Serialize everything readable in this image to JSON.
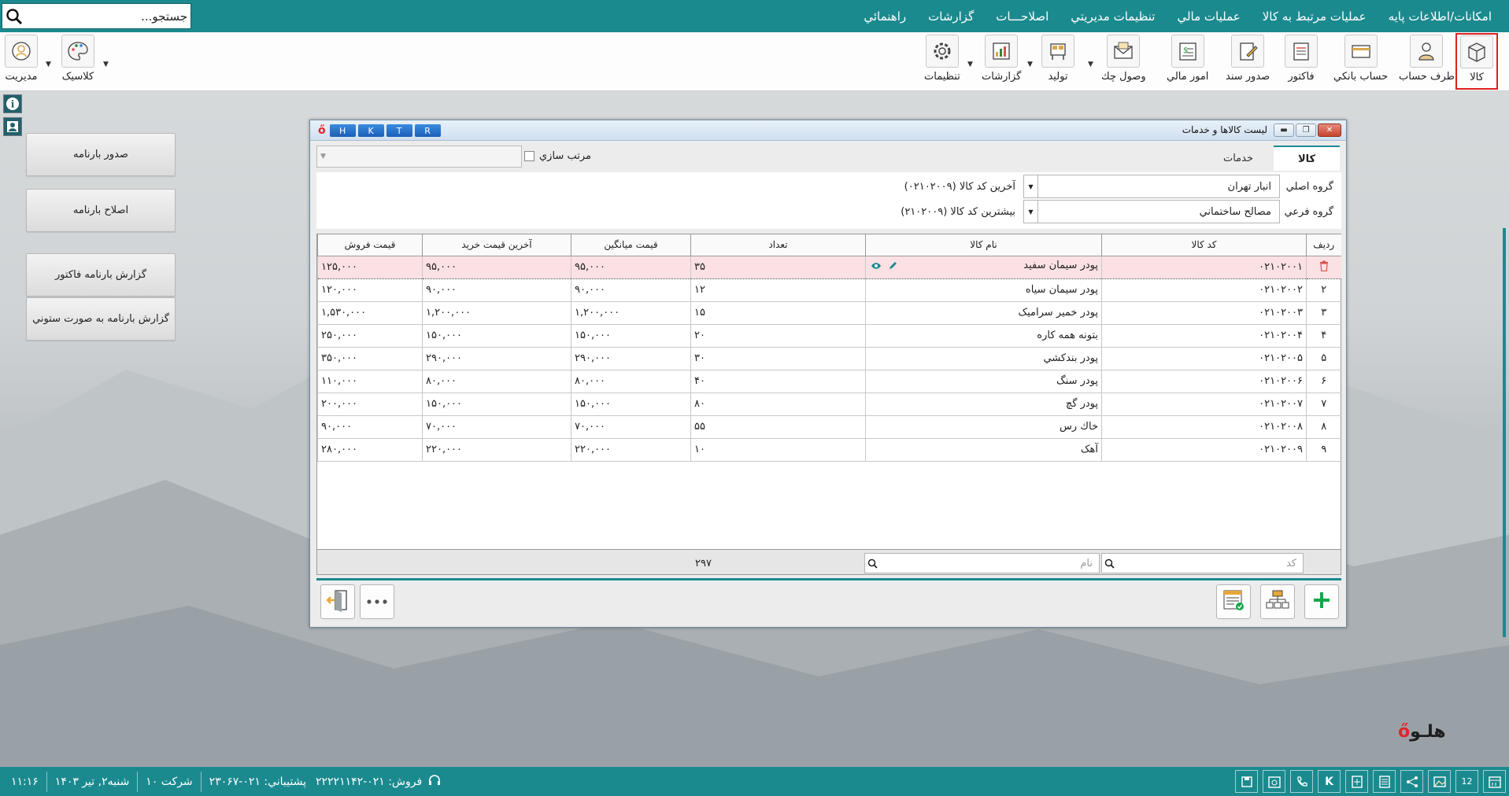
{
  "menu": {
    "items": [
      "امکانات/اطلاعات پایه",
      "عملیات مرتبط به کالا",
      "عملیات مالي",
      "تنظیمات مدیریتي",
      "اصلاحـــات",
      "گزارشات",
      "راهنمائي"
    ]
  },
  "search": {
    "placeholder": "جستجو..."
  },
  "toolbar": {
    "right": [
      "کالا",
      "طرف حساب",
      "حساب بانکي",
      "فاکتور",
      "صدور سند",
      "امور مالي",
      "وصول چك",
      "تولید",
      "گزارشات",
      "تنظیمات"
    ],
    "left": [
      "کلاسیک",
      "مدیریت"
    ]
  },
  "sidebar": {
    "buttons": [
      "صدور بارنامه",
      "اصلاح بارنامه",
      "گزارش بارنامه فاکتور",
      "گزارش بارنامه به صورت ستوني"
    ]
  },
  "window": {
    "title": "لیست کالاها و خدمات",
    "hotkeys": [
      "H",
      "K",
      "T",
      "R"
    ],
    "tabs": [
      "کالا",
      "خدمات"
    ],
    "sort_label": "مرتب سازي",
    "main_group_label": "گروه اصلي",
    "main_group_value": "انبار تهران",
    "main_group_info": "آخرین کد کالا (۰۲۱۰۲۰۰۹)",
    "sub_group_label": "گروه فرعي",
    "sub_group_value": "مصالح ساختماني",
    "sub_group_info": "بیشترین کد کالا (۲۱۰۲۰۰۹)"
  },
  "table": {
    "headers": [
      "ردیف",
      "کد کالا",
      "نام کالا",
      "تعداد",
      "قیمت میانگین",
      "آخرین قیمت خرید",
      "قیمت فروش"
    ],
    "rows": [
      [
        "",
        "۰۲۱۰۲۰۰۱",
        "پودر سیمان سفید",
        "۳۵",
        "۹۵,۰۰۰",
        "۹۵,۰۰۰",
        "۱۲۵,۰۰۰"
      ],
      [
        "۲",
        "۰۲۱۰۲۰۰۲",
        "پودر سیمان سیاه",
        "۱۲",
        "۹۰,۰۰۰",
        "۹۰,۰۰۰",
        "۱۲۰,۰۰۰"
      ],
      [
        "۳",
        "۰۲۱۰۲۰۰۳",
        "پودر خمیر سرامیک",
        "۱۵",
        "۱,۲۰۰,۰۰۰",
        "۱,۲۰۰,۰۰۰",
        "۱,۵۳۰,۰۰۰"
      ],
      [
        "۴",
        "۰۲۱۰۲۰۰۴",
        "بتونه همه کاره",
        "۲۰",
        "۱۵۰,۰۰۰",
        "۱۵۰,۰۰۰",
        "۲۵۰,۰۰۰"
      ],
      [
        "۵",
        "۰۲۱۰۲۰۰۵",
        "پودر بندکشي",
        "۳۰",
        "۲۹۰,۰۰۰",
        "۲۹۰,۰۰۰",
        "۳۵۰,۰۰۰"
      ],
      [
        "۶",
        "۰۲۱۰۲۰۰۶",
        "پودر سنگ",
        "۴۰",
        "۸۰,۰۰۰",
        "۸۰,۰۰۰",
        "۱۱۰,۰۰۰"
      ],
      [
        "۷",
        "۰۲۱۰۲۰۰۷",
        "پودر گچ",
        "۸۰",
        "۱۵۰,۰۰۰",
        "۱۵۰,۰۰۰",
        "۲۰۰,۰۰۰"
      ],
      [
        "۸",
        "۰۲۱۰۲۰۰۸",
        "خاك رس",
        "۵۵",
        "۷۰,۰۰۰",
        "۷۰,۰۰۰",
        "۹۰,۰۰۰"
      ],
      [
        "۹",
        "۰۲۱۰۲۰۰۹",
        "آهک",
        "۱۰",
        "۲۲۰,۰۰۰",
        "۲۲۰,۰۰۰",
        "۲۸۰,۰۰۰"
      ]
    ],
    "footer": {
      "code_placeholder": "کد",
      "name_placeholder": "نام",
      "total_count": "۲۹۷"
    }
  },
  "statusbar": {
    "datetime": "شنبه۲, تیر ۱۴۰۳",
    "time": "۱۱:۱۶",
    "company": "شرکت ۱۰",
    "support": "پشتیباني: ۰۲۱-۲۳۰۶۷",
    "sales": "فروش: ۰۲۱-۲۲۲۲۱۱۴۲"
  },
  "brand": {
    "name": "هلـو"
  },
  "colors": {
    "teal": "#1b8a8f",
    "selected_row": "#fbe1e4",
    "active_border": "#e02020",
    "add_green": "#12a84a"
  }
}
